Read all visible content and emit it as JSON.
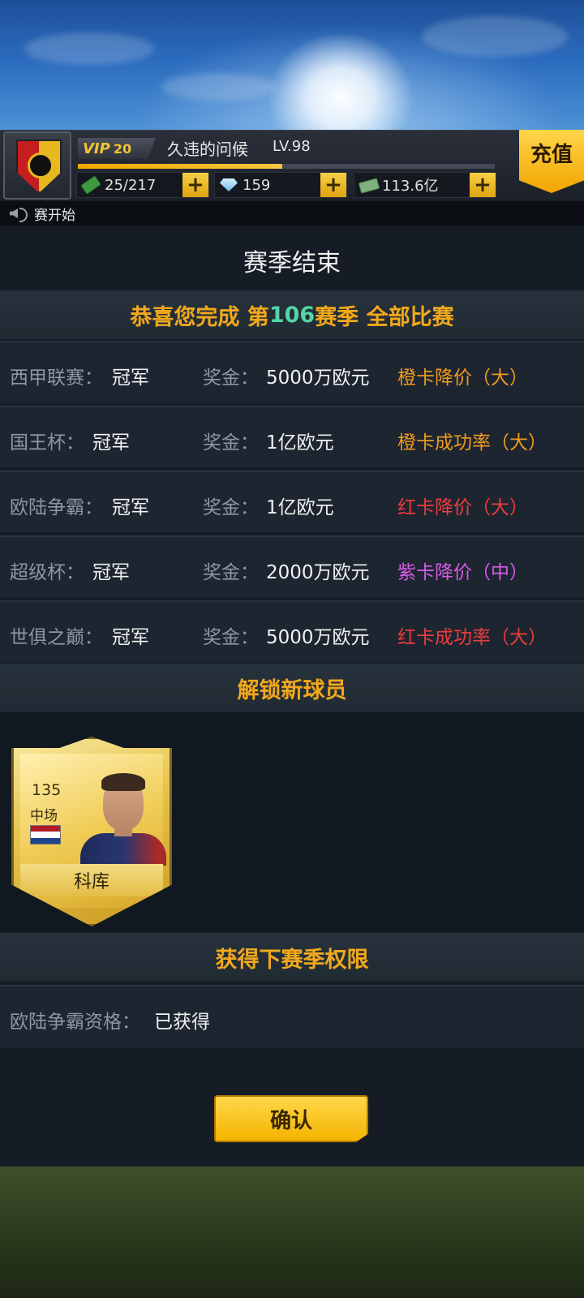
{
  "header": {
    "vip_tag": "VIP",
    "vip_level": "20",
    "player_name": "久违的问候",
    "player_level": "LV.98",
    "xp_progress": 0.49,
    "resources": [
      {
        "icon": "stamina-icon",
        "value": "25/217"
      },
      {
        "icon": "diamond-icon",
        "value": "159"
      },
      {
        "icon": "money-icon",
        "value": "113.6亿"
      }
    ],
    "plus_label": "+",
    "charge_label": "充值"
  },
  "notice": {
    "text": "赛开始"
  },
  "panel": {
    "title": "赛季结束",
    "congrats_prefix": "恭喜您完成 第",
    "season_number": "106",
    "congrats_suffix": "赛季 全部比赛",
    "prize_label": "奖金：",
    "results": [
      {
        "competition": "西甲联赛：",
        "result": "冠军",
        "prize": "5000万欧元",
        "reward": "橙卡降价（大）",
        "reward_color": "#f09a1e"
      },
      {
        "competition": "国王杯：",
        "result": "冠军",
        "prize": "1亿欧元",
        "reward": "橙卡成功率（大）",
        "reward_color": "#f09a1e"
      },
      {
        "competition": "欧陆争霸：",
        "result": "冠军",
        "prize": "1亿欧元",
        "reward": "红卡降价（大）",
        "reward_color": "#ef3b3b"
      },
      {
        "competition": "超级杯：",
        "result": "冠军",
        "prize": "2000万欧元",
        "reward": "紫卡降价（中）",
        "reward_color": "#d65ae6"
      },
      {
        "competition": "世俱之巅：",
        "result": "冠军",
        "prize": "5000万欧元",
        "reward": "红卡成功率（大）",
        "reward_color": "#ef3b3b"
      }
    ],
    "unlock_title": "解锁新球员",
    "unlocked_player": {
      "rating": "135",
      "position": "中场",
      "name": "科库",
      "flag_colors": [
        "#ae1c28",
        "#ffffff",
        "#21468b"
      ]
    },
    "next_title": "获得下赛季权限",
    "qualification_label": "欧陆争霸资格：",
    "qualification_value": "已获得",
    "confirm_label": "确认"
  }
}
